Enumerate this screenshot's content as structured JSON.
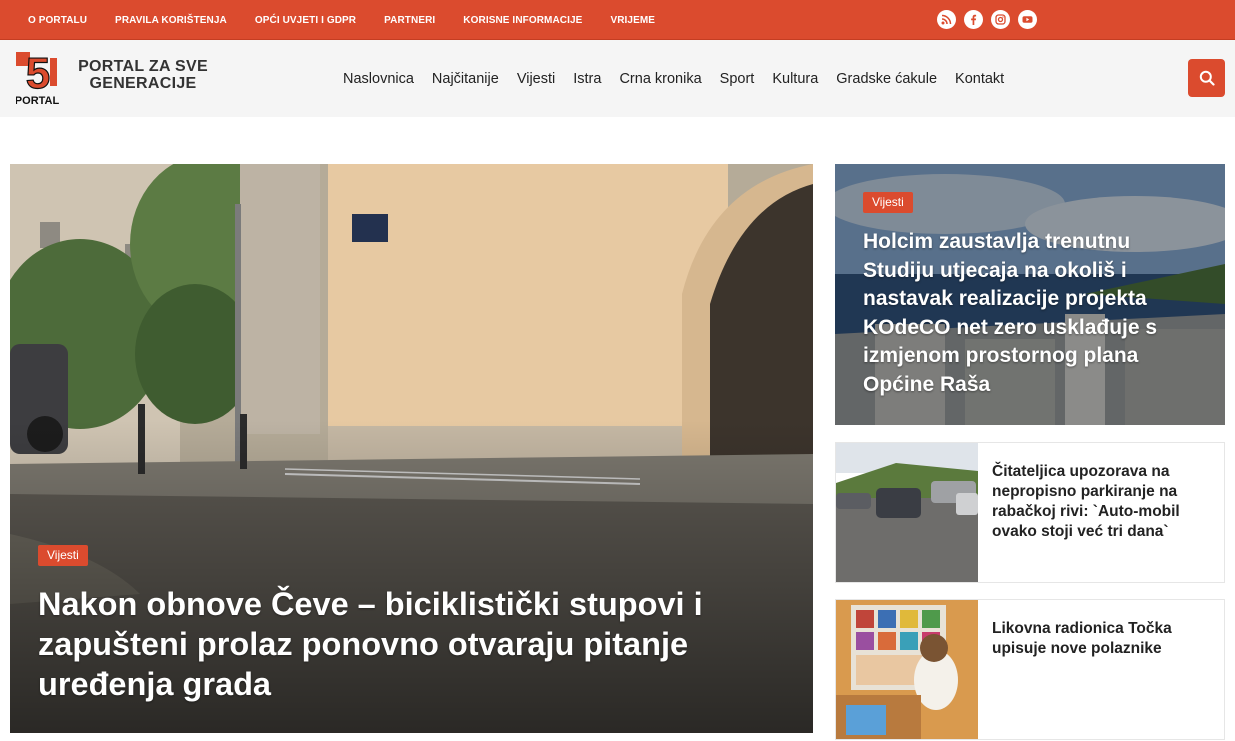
{
  "topbar": {
    "links": [
      "O PORTALU",
      "PRAVILA KORIŠTENJA",
      "OPĆI UVJETI I GDPR",
      "PARTNERI",
      "KORISNE INFORMACIJE",
      "VRIJEME"
    ],
    "social_icons": [
      "rss-icon",
      "facebook-icon",
      "instagram-icon",
      "youtube-icon"
    ],
    "color": "#db4b2e"
  },
  "header": {
    "logo": {
      "number": "5",
      "word": "PORTAL"
    },
    "site_name_line1": "PORTAL ZA SVE",
    "site_name_line2": "GENERACIJE",
    "nav": [
      "Naslovnica",
      "Najčitanije",
      "Vijesti",
      "Istra",
      "Crna kronika",
      "Sport",
      "Kultura",
      "Gradske ćakule",
      "Kontakt"
    ],
    "search_icon": "search-icon"
  },
  "hero": {
    "category": "Vijesti",
    "title": "Nakon obnove Čeve – biciklistički stupovi i zapušteni prolaz ponovno otvaraju pitanje uređenja grada"
  },
  "side_feature": {
    "category": "Vijesti",
    "title": "Holcim zaustavlja trenutnu Studiju utjecaja na okoliš i nastavak realizacije projekta KOdeCO net zero usklađuje s izmjenom prostornog plana Općine Raša"
  },
  "cards": [
    {
      "title": "Čitateljica upozorava na nepropisno parkiranje na rabačkoj rivi: `Auto-mobil ovako stoji već tri dana`"
    },
    {
      "title": "Likovna radionica Točka upisuje nove polaznike"
    }
  ]
}
